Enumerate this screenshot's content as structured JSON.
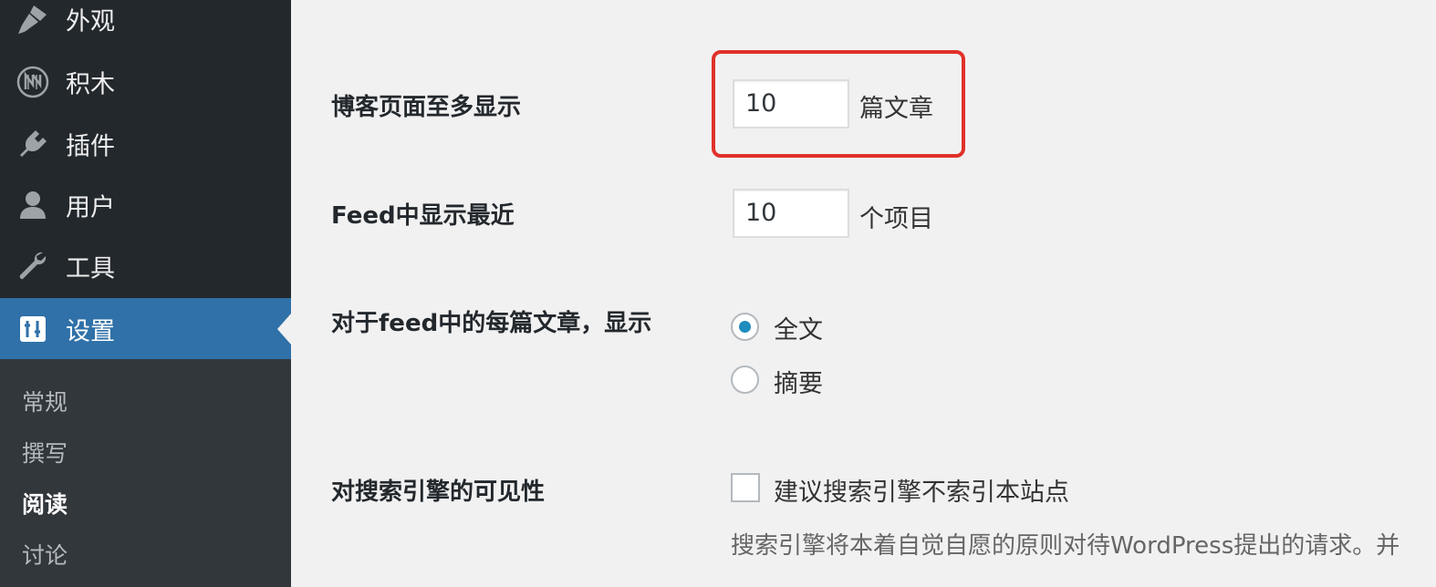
{
  "sidebar": {
    "items": [
      {
        "label": "外观",
        "icon": "paintbrush-icon"
      },
      {
        "label": "积木",
        "icon": "blocks-logo-icon"
      },
      {
        "label": "插件",
        "icon": "plugin-icon"
      },
      {
        "label": "用户",
        "icon": "user-icon"
      },
      {
        "label": "工具",
        "icon": "wrench-icon"
      },
      {
        "label": "设置",
        "icon": "settings-icon"
      }
    ],
    "submenu": [
      "常规",
      "撰写",
      "阅读",
      "讨论"
    ]
  },
  "settings": {
    "posts_per_page": {
      "label": "博客页面至多显示",
      "value": "10",
      "suffix": "篇文章"
    },
    "posts_per_rss": {
      "label": "Feed中显示最近",
      "value": "10",
      "suffix": "个项目"
    },
    "rss_use_excerpt": {
      "label": "对于feed中的每篇文章，显示",
      "options": [
        "全文",
        "摘要"
      ],
      "selected": "全文"
    },
    "search_visibility": {
      "label": "对搜索引擎的可见性",
      "checkbox_label": "建议搜索引擎不索引本站点",
      "checked": false,
      "description": "搜索引擎将本着自觉自愿的原则对待WordPress提出的请求。并"
    }
  },
  "colors": {
    "sidebar_bg": "#23282d",
    "active_bg": "#2f71a8",
    "submenu_bg": "#32373c",
    "highlight": "#e0312a",
    "radio_dot": "#1e8cbe"
  }
}
